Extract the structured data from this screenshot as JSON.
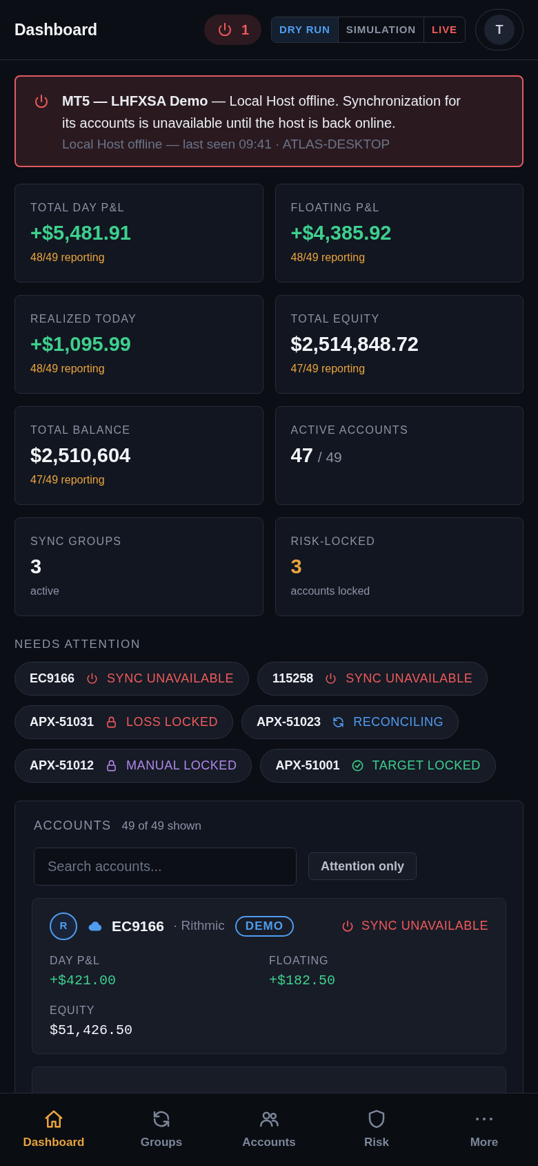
{
  "header": {
    "title": "Dashboard",
    "offline_count": "1",
    "modes": [
      {
        "label": "DRY RUN",
        "kind": "dry",
        "selected": true
      },
      {
        "label": "SIMULATION",
        "kind": "sim",
        "selected": false
      },
      {
        "label": "LIVE",
        "kind": "live",
        "selected": false
      }
    ],
    "avatar": "T"
  },
  "alert": {
    "message": "**MT5 — LHFXSA Demo** — Local Host offline. Synchronization for its accounts is unavailable until the host is back online.",
    "detail": "Local Host offline — last seen 09:41 · ATLAS-DESKTOP"
  },
  "stats": [
    {
      "label": "TOTAL DAY P&L",
      "value": "+$5,481.91",
      "kind": "pnl",
      "sub": "48/49 reporting"
    },
    {
      "label": "FLOATING P&L",
      "value": "+$4,385.92",
      "kind": "pnl",
      "sub": "48/49 reporting"
    },
    {
      "label": "REALIZED TODAY",
      "value": "+$1,095.99",
      "kind": "pnl",
      "sub": "48/49 reporting"
    },
    {
      "label": "TOTAL EQUITY",
      "value": "$2,514,848.72",
      "kind": "total",
      "sub": "47/49 reporting"
    },
    {
      "label": "TOTAL BALANCE",
      "value": "$2,510,604",
      "kind": "total",
      "sub": "47/49 reporting"
    },
    {
      "label": "ACTIVE ACCOUNTS",
      "value": "47",
      "total": "/ 49",
      "kind": "count"
    },
    {
      "label": "SYNC GROUPS",
      "value": "3",
      "kind": "count",
      "sub": "active"
    },
    {
      "label": "RISK-LOCKED",
      "value": "3",
      "kind": "locked",
      "sub": "accounts locked"
    }
  ],
  "attention": {
    "title": "NEEDS ATTENTION",
    "items": [
      {
        "account": "EC9166",
        "status": "SYNC UNAVAILABLE",
        "kind": "offline"
      },
      {
        "account": "115258",
        "status": "SYNC UNAVAILABLE",
        "kind": "offline"
      },
      {
        "account": "APX-51031",
        "status": "LOSS LOCKED",
        "kind": "loss"
      },
      {
        "account": "APX-51023",
        "status": "RECONCILING",
        "kind": "reconciling"
      },
      {
        "account": "APX-51012",
        "status": "MANUAL LOCKED",
        "kind": "manual"
      },
      {
        "account": "APX-51001",
        "status": "TARGET LOCKED",
        "kind": "target"
      }
    ]
  },
  "accounts": {
    "title": "ACCOUNTS",
    "count": "49 of 49 shown",
    "search": {
      "placeholder": "Search accounts..."
    },
    "filter": {
      "label": "Attention only",
      "selected": false
    },
    "cards": [
      {
        "initial": "R",
        "name": "EC9166",
        "broker": "· Rithmic",
        "tag": "DEMO",
        "status": "SYNC UNAVAILABLE",
        "kind": "offline",
        "metrics": [
          {
            "label": "DAY P&L",
            "value": "+$421.00",
            "kind": "pnl"
          },
          {
            "label": "FLOATING",
            "value": "+$182.50",
            "kind": "pnl"
          },
          {
            "label": "EQUITY",
            "value": "$51,426.50",
            "kind": "total"
          }
        ]
      }
    ]
  },
  "nav": [
    {
      "label": "Dashboard",
      "selected": true
    },
    {
      "label": "Groups",
      "selected": false
    },
    {
      "label": "Accounts",
      "selected": false
    },
    {
      "label": "Risk",
      "selected": false
    },
    {
      "label": "More",
      "selected": false
    }
  ]
}
